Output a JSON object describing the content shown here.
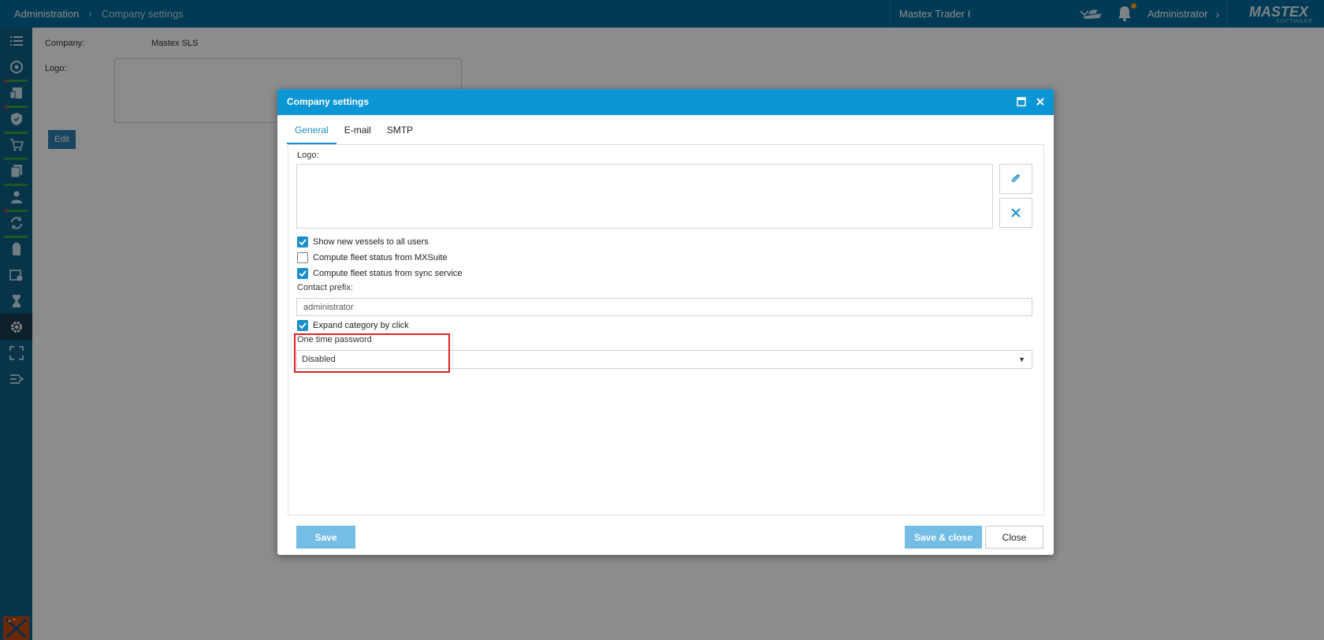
{
  "topbar": {
    "breadcrumb_root": "Administration",
    "breadcrumb_current": "Company settings",
    "vessel": "Mastex Trader I",
    "user": "Administrator",
    "brand_logo": "MASTEX",
    "brand_sub": "SOFTWARE"
  },
  "page": {
    "company_label": "Company:",
    "company_value": "Mastex SLS",
    "logo_label": "Logo:",
    "edit_label": "Edit"
  },
  "dialog": {
    "title": "Company settings",
    "tabs": [
      {
        "label": "General",
        "active": true
      },
      {
        "label": "E-mail",
        "active": false
      },
      {
        "label": "SMTP",
        "active": false
      }
    ],
    "logo_label": "Logo:",
    "checkboxes": [
      {
        "label": "Show new vessels to all users",
        "checked": true
      },
      {
        "label": "Compute fleet status from MXSuite",
        "checked": false
      },
      {
        "label": "Compute fleet status from sync service",
        "checked": true
      }
    ],
    "contact_prefix_label": "Contact prefix:",
    "contact_prefix_value": "administrator",
    "expand_category": {
      "label": "Expand category by click",
      "checked": true
    },
    "otp_label": "One time password",
    "otp_value": "Disabled",
    "save_label": "Save",
    "save_close_label": "Save & close",
    "close_label": "Close"
  },
  "colors": {
    "topbar": "#006a9a",
    "sidebar": "#0d5f86",
    "dialog_header": "#0a95d5",
    "accent": "#1a8fc9",
    "highlight": "#e02020"
  }
}
